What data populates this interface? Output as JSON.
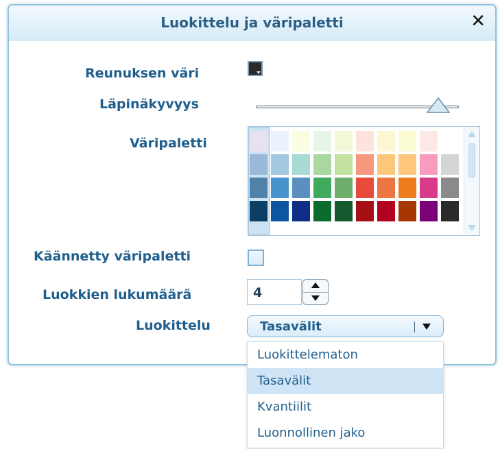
{
  "dialog": {
    "title": "Luokittelu ja väripaletti",
    "close_glyph": "✕"
  },
  "labels": {
    "border_color": "Reunuksen väri",
    "opacity": "Läpinäkyvyys",
    "palette": "Väripaletti",
    "reversed_palette": "Käännetty väripaletti",
    "class_count": "Luokkien lukumäärä",
    "classification": "Luokittelu"
  },
  "border_color": {
    "value": "#2a2a2a",
    "icon": "color-swatch-icon"
  },
  "opacity": {
    "level": 0.9
  },
  "palette": {
    "rows": [
      [
        "#e8e2f0",
        "#eaf3fc",
        "#fbfde0",
        "#e6f6e6",
        "#f3f9d8",
        "#fde3dc",
        "#fdf6d2",
        "#fbfbd4",
        "#fde8e6",
        "#ffffff"
      ],
      [
        "#9ab9d8",
        "#a4c8e2",
        "#a8dbd3",
        "#a8d89d",
        "#c3e29f",
        "#f7977e",
        "#fdc77a",
        "#fdc67a",
        "#f89bbd",
        "#d5d5d5"
      ],
      [
        "#4f82a8",
        "#4793cb",
        "#5a8fc0",
        "#41ab5d",
        "#6fae6a",
        "#e74b3c",
        "#ed7743",
        "#ec7c1c",
        "#d93b8b",
        "#8a8a8a"
      ],
      [
        "#0b3f66",
        "#0d55a0",
        "#0f2f87",
        "#0b6b2c",
        "#145a2e",
        "#a50f15",
        "#b3001f",
        "#a63603",
        "#7a0177",
        "#2b2b2b"
      ]
    ],
    "selected_column": 0
  },
  "reversed_palette": {
    "checked": false
  },
  "class_count": {
    "value": "4"
  },
  "classification": {
    "selected": "Tasavälit",
    "options": [
      "Luokittelematon",
      "Tasavälit",
      "Kvantiilit",
      "Luonnollinen jako"
    ],
    "selected_index": 1
  },
  "colors": {
    "accent": "#1f5f8d",
    "title_bar": "#d6ebf7",
    "dialog_border": "#8ec4e0",
    "selection": "#cfe5f6"
  }
}
